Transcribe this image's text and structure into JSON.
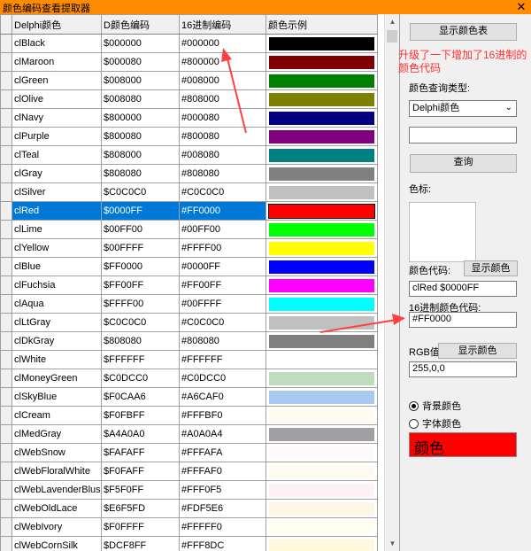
{
  "window": {
    "title": "颜色编码查看提取器",
    "close_glyph": "✕"
  },
  "grid": {
    "headers": [
      "Delphi颜色",
      "D颜色编码",
      "16进制编码",
      "颜色示例"
    ],
    "selected_index": 9,
    "rows": [
      {
        "name": "clBlack",
        "dcode": "$000000",
        "hex": "#000000",
        "color": "#000000"
      },
      {
        "name": "clMaroon",
        "dcode": "$000080",
        "hex": "#800000",
        "color": "#800000"
      },
      {
        "name": "clGreen",
        "dcode": "$008000",
        "hex": "#008000",
        "color": "#008000"
      },
      {
        "name": "clOlive",
        "dcode": "$008080",
        "hex": "#808000",
        "color": "#808000"
      },
      {
        "name": "clNavy",
        "dcode": "$800000",
        "hex": "#000080",
        "color": "#000080"
      },
      {
        "name": "clPurple",
        "dcode": "$800080",
        "hex": "#800080",
        "color": "#800080"
      },
      {
        "name": "clTeal",
        "dcode": "$808000",
        "hex": "#008080",
        "color": "#008080"
      },
      {
        "name": "clGray",
        "dcode": "$808080",
        "hex": "#808080",
        "color": "#808080"
      },
      {
        "name": "clSilver",
        "dcode": "$C0C0C0",
        "hex": "#C0C0C0",
        "color": "#C0C0C0"
      },
      {
        "name": "clRed",
        "dcode": "$0000FF",
        "hex": "#FF0000",
        "color": "#FF0000"
      },
      {
        "name": "clLime",
        "dcode": "$00FF00",
        "hex": "#00FF00",
        "color": "#00FF00"
      },
      {
        "name": "clYellow",
        "dcode": "$00FFFF",
        "hex": "#FFFF00",
        "color": "#FFFF00"
      },
      {
        "name": "clBlue",
        "dcode": "$FF0000",
        "hex": "#0000FF",
        "color": "#0000FF"
      },
      {
        "name": "clFuchsia",
        "dcode": "$FF00FF",
        "hex": "#FF00FF",
        "color": "#FF00FF"
      },
      {
        "name": "clAqua",
        "dcode": "$FFFF00",
        "hex": "#00FFFF",
        "color": "#00FFFF"
      },
      {
        "name": "clLtGray",
        "dcode": "$C0C0C0",
        "hex": "#C0C0C0",
        "color": "#C0C0C0"
      },
      {
        "name": "clDkGray",
        "dcode": "$808080",
        "hex": "#808080",
        "color": "#808080"
      },
      {
        "name": "clWhite",
        "dcode": "$FFFFFF",
        "hex": "#FFFFFF",
        "color": "#FFFFFF"
      },
      {
        "name": "clMoneyGreen",
        "dcode": "$C0DCC0",
        "hex": "#C0DCC0",
        "color": "#C0DCC0"
      },
      {
        "name": "clSkyBlue",
        "dcode": "$F0CAA6",
        "hex": "#A6CAF0",
        "color": "#A6CAF0"
      },
      {
        "name": "clCream",
        "dcode": "$F0FBFF",
        "hex": "#FFFBF0",
        "color": "#FFFBF0"
      },
      {
        "name": "clMedGray",
        "dcode": "$A4A0A0",
        "hex": "#A0A0A4",
        "color": "#A0A0A4"
      },
      {
        "name": "clWebSnow",
        "dcode": "$FAFAFF",
        "hex": "#FFFAFA",
        "color": "#FFFAFA"
      },
      {
        "name": "clWebFloralWhite",
        "dcode": "$F0FAFF",
        "hex": "#FFFAF0",
        "color": "#FFFAF0"
      },
      {
        "name": "clWebLavenderBlush",
        "dcode": "$F5F0FF",
        "hex": "#FFF0F5",
        "color": "#FFF0F5"
      },
      {
        "name": "clWebOldLace",
        "dcode": "$E6F5FD",
        "hex": "#FDF5E6",
        "color": "#FDF5E6"
      },
      {
        "name": "clWebIvory",
        "dcode": "$F0FFFF",
        "hex": "#FFFFF0",
        "color": "#FFFFF0"
      },
      {
        "name": "clWebCornSilk",
        "dcode": "$DCF8FF",
        "hex": "#FFF8DC",
        "color": "#FFF8DC"
      }
    ]
  },
  "panel": {
    "show_table_label": "显示颜色表",
    "annotation": "升级了一下增加了16进制的颜色代码",
    "query_type_label": "颜色查询类型:",
    "query_type_value": "Delphi颜色",
    "query_input_value": "",
    "query_button": "查询",
    "swatch_label": "色标:",
    "color_code_label": "颜色代码:",
    "show_color_button": "显示颜色",
    "color_code_value": "clRed $0000FF",
    "hex_code_label": "16进制颜色代码:",
    "hex_code_value": "#FF0000",
    "rgb_label": "RGB值",
    "rgb_show_button": "显示颜色",
    "rgb_value": "255,0,0",
    "radio_bg": "背景颜色",
    "radio_font": "字体颜色",
    "radio_selected": "背景颜色",
    "sample_text": "颜色",
    "sample_color": "#FF0000"
  },
  "colors": {
    "titlebar": "#FF8C00",
    "selection": "#0078D7",
    "annotation": "#FF3030"
  }
}
